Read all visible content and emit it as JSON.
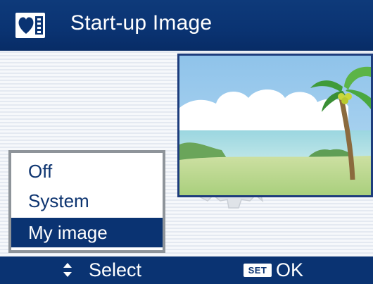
{
  "header": {
    "icon": "heart-card-icon",
    "title": "Start-up Image"
  },
  "menu": {
    "items": [
      {
        "label": "Off",
        "selected": false
      },
      {
        "label": "System",
        "selected": false
      },
      {
        "label": "My image",
        "selected": true
      }
    ]
  },
  "preview": {
    "icon": "beach-palm-image"
  },
  "footer": {
    "select_icon": "up-down-arrows-icon",
    "select_label": "Select",
    "set_badge": "SET",
    "ok_label": "OK"
  },
  "colors": {
    "bar_blue": "#0a3372",
    "menu_text": "#0d3470",
    "menu_border": "#8e949a",
    "preview_border": "#1d3c7c"
  }
}
